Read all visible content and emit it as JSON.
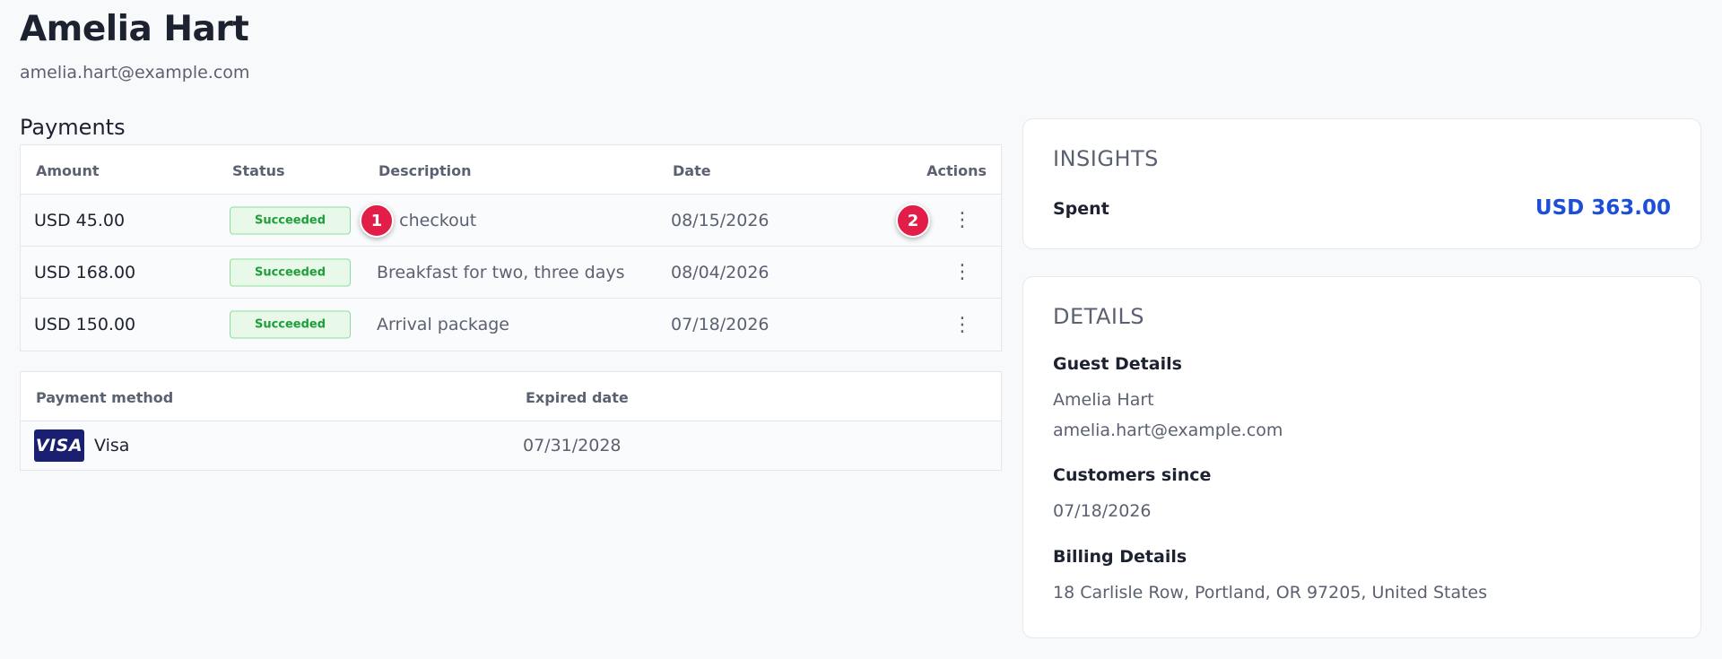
{
  "customer": {
    "name": "Amelia Hart",
    "email": "amelia.hart@example.com"
  },
  "payments": {
    "title": "Payments",
    "columns": {
      "amount": "Amount",
      "status": "Status",
      "description": "Description",
      "date": "Date",
      "actions": "Actions"
    },
    "rows": [
      {
        "amount": "USD 45.00",
        "status": "Succeeded",
        "description": "te checkout",
        "date": "08/15/2026",
        "action_icon": "more-vertical-icon"
      },
      {
        "amount": "USD 168.00",
        "status": "Succeeded",
        "description": "Breakfast for two, three days",
        "date": "08/04/2026",
        "action_icon": "more-vertical-icon"
      },
      {
        "amount": "USD 150.00",
        "status": "Succeeded",
        "description": "Arrival package",
        "date": "07/18/2026",
        "action_icon": "more-vertical-icon"
      }
    ],
    "action_glyph": "⋮"
  },
  "payment_method": {
    "columns": {
      "method": "Payment method",
      "expired": "Expired date"
    },
    "row": {
      "logo_text": "VISA",
      "label": "Visa",
      "expired": "07/31/2028"
    }
  },
  "insights": {
    "title": "INSIGHTS",
    "spent_label": "Spent",
    "spent_value": "USD 363.00"
  },
  "details": {
    "title": "DETAILS",
    "guest_heading": "Guest Details",
    "guest_name": "Amelia Hart",
    "guest_email": "amelia.hart@example.com",
    "since_heading": "Customers since",
    "since_value": "07/18/2026",
    "billing_heading": "Billing Details",
    "billing_address": "18 Carlisle Row, Portland, OR 97205, United States"
  },
  "markers": [
    "1",
    "2"
  ],
  "colors": {
    "accent_blue": "#1d4ed8",
    "success_green": "#1f9d3a",
    "marker_red": "#e11d48",
    "visa_navy": "#1a1f71"
  }
}
